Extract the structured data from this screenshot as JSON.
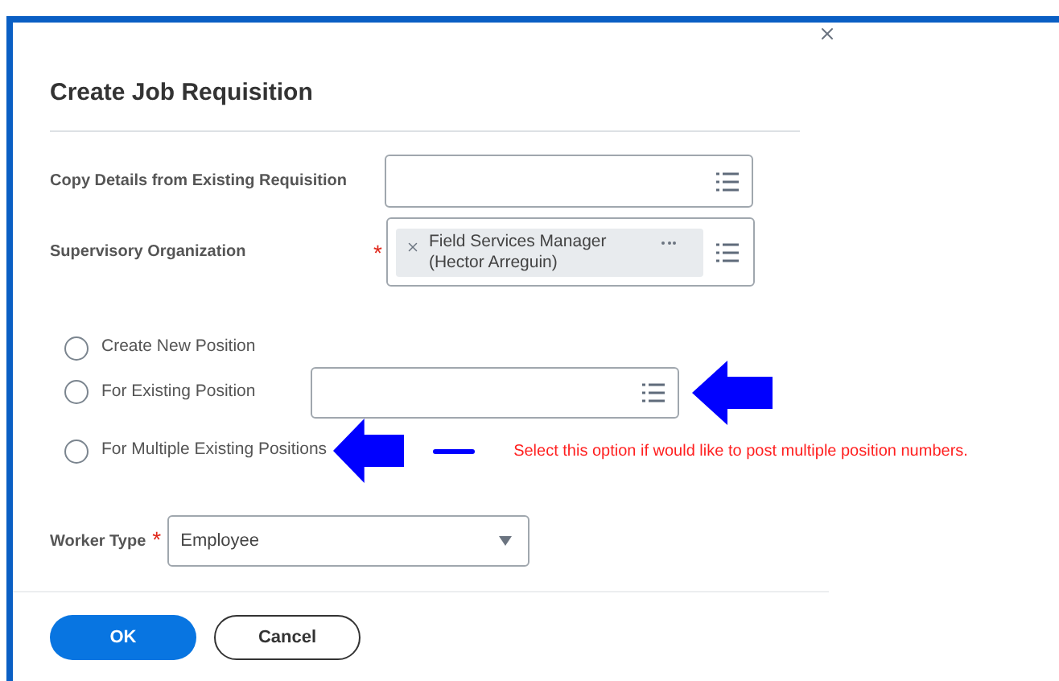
{
  "dialog": {
    "title": "Create Job Requisition"
  },
  "fields": [
    {
      "label": "Copy Details from Existing Requisition"
    },
    {
      "label": "Supervisory Organization",
      "required_mark": "*",
      "pill": {
        "line1": "Field Services Manager",
        "line2": "(Hector Arreguin)"
      }
    }
  ],
  "position_options": [
    {
      "label": "Create New Position",
      "selected": false,
      "kind": "plain"
    },
    {
      "label": "For Existing Position",
      "selected": false,
      "kind": "prompt"
    },
    {
      "label": "For Multiple Existing Positions",
      "selected": false,
      "kind": "annotated"
    }
  ],
  "annotation": {
    "note": "Select this option if would like to post multiple position numbers."
  },
  "worker_type": {
    "label": "Worker Type",
    "required_mark": "*",
    "value": "Employee"
  },
  "buttons": [
    {
      "label": "OK",
      "kind": "primary"
    },
    {
      "label": "Cancel",
      "kind": "secondary"
    }
  ]
}
